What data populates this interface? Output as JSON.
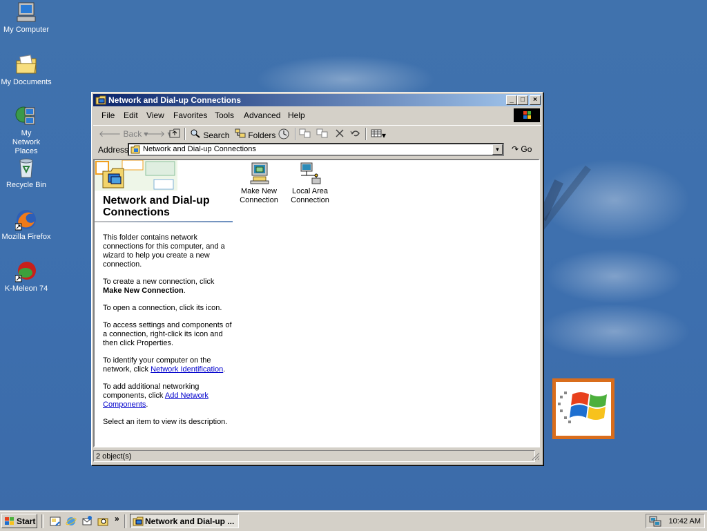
{
  "desktop": {
    "icons": [
      {
        "label": "My Computer",
        "icon": "my-computer-icon"
      },
      {
        "label": "My Documents",
        "icon": "my-documents-icon"
      },
      {
        "label": "My Network Places",
        "icon": "network-places-icon"
      },
      {
        "label": "Recycle Bin",
        "icon": "recycle-bin-icon"
      },
      {
        "label": "Mozilla Firefox",
        "icon": "firefox-icon"
      },
      {
        "label": "K-Meleon 74",
        "icon": "k-meleon-icon"
      }
    ]
  },
  "window": {
    "title": "Network and Dial-up Connections",
    "menu": [
      "File",
      "Edit",
      "View",
      "Favorites",
      "Tools",
      "Advanced",
      "Help"
    ],
    "toolbar": {
      "back": "Back",
      "search": "Search",
      "folders": "Folders"
    },
    "address": {
      "label": "Address",
      "value": "Network and Dial-up Connections",
      "go": "Go"
    },
    "panel": {
      "heading": "Network and Dial-up Connections",
      "p1": "This folder contains network connections for this computer, and a wizard to help you create a new connection.",
      "p2_pre": "To create a new connection, click",
      "p2_bold": "Make New Connection",
      "p3": "To open a connection, click its icon.",
      "p4": "To access settings and components of a connection, right-click its icon and then click Properties.",
      "p5_pre": "To identify your computer on the network, click",
      "p5_link": "Network Identification",
      "p6_pre": "To add additional networking components, click",
      "p6_link": "Add Network Components",
      "p7": "Select an item to view its description."
    },
    "items": [
      {
        "line1": "Make New",
        "line2": "Connection"
      },
      {
        "line1": "Local Area",
        "line2": "Connection"
      }
    ],
    "status": "2 object(s)"
  },
  "taskbar": {
    "start": "Start",
    "task_label": "Network and Dial-up ...",
    "clock": "10:42 AM"
  }
}
